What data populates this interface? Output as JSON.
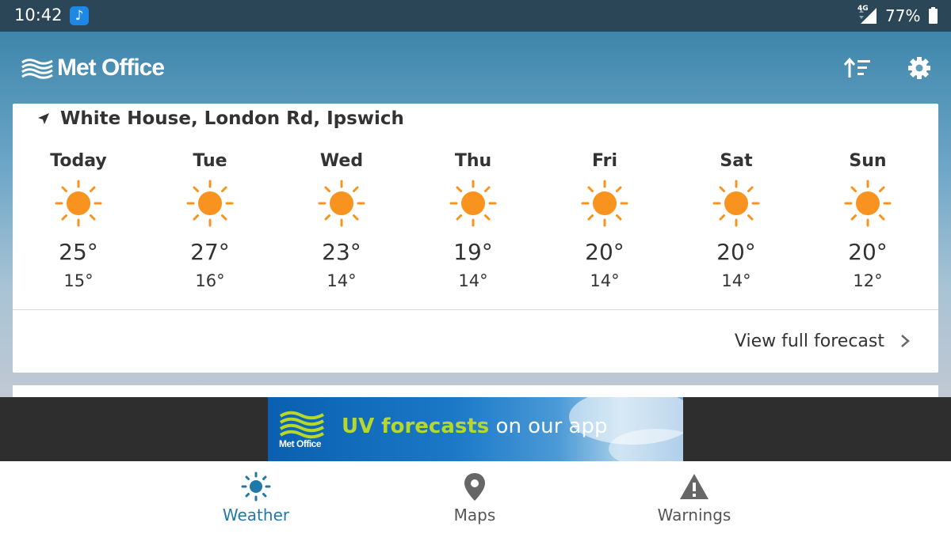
{
  "status_bar": {
    "time": "10:42",
    "network": "4G",
    "battery": "77%"
  },
  "header": {
    "logo_text": "Met Office",
    "sort_icon": "sort-icon",
    "settings_icon": "gear-icon"
  },
  "forecast": {
    "location": "White House, London Rd, Ipswich",
    "days": [
      {
        "name": "Today",
        "max": "25°",
        "min": "15°",
        "icon": "sunny"
      },
      {
        "name": "Tue",
        "max": "27°",
        "min": "16°",
        "icon": "sunny"
      },
      {
        "name": "Wed",
        "max": "23°",
        "min": "14°",
        "icon": "sunny"
      },
      {
        "name": "Thu",
        "max": "19°",
        "min": "14°",
        "icon": "sunny"
      },
      {
        "name": "Fri",
        "max": "20°",
        "min": "14°",
        "icon": "sunny"
      },
      {
        "name": "Sat",
        "max": "20°",
        "min": "14°",
        "icon": "sunny"
      },
      {
        "name": "Sun",
        "max": "20°",
        "min": "12°",
        "icon": "sunny"
      }
    ],
    "view_full": "View full forecast"
  },
  "ad": {
    "logo_text": "Met Office",
    "highlight": "UV forecasts",
    "rest": " on our app"
  },
  "bottom_nav": {
    "items": [
      {
        "label": "Weather",
        "icon": "sun-icon",
        "active": true
      },
      {
        "label": "Maps",
        "icon": "map-pin-icon",
        "active": false
      },
      {
        "label": "Warnings",
        "icon": "warning-icon",
        "active": false
      }
    ]
  },
  "colors": {
    "accent": "#1f79a8",
    "sun": "#f7931e",
    "status_bar": "#2a4657"
  }
}
